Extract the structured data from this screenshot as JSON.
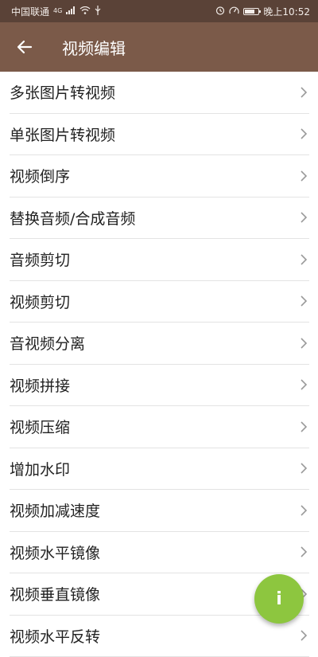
{
  "status_bar": {
    "carrier": "中国联通",
    "network_type": "4G",
    "time": "晚上10:52",
    "icons": [
      "signal-icon",
      "wifi-icon",
      "usb-icon",
      "alarm-icon",
      "speed-icon",
      "battery-icon"
    ]
  },
  "app_bar": {
    "title": "视频编辑",
    "back_icon": "arrow-left-icon"
  },
  "menu": {
    "items": [
      {
        "label": "多张图片转视频"
      },
      {
        "label": "单张图片转视频"
      },
      {
        "label": "视频倒序"
      },
      {
        "label": "替换音频/合成音频"
      },
      {
        "label": "音频剪切"
      },
      {
        "label": "视频剪切"
      },
      {
        "label": "音视频分离"
      },
      {
        "label": "视频拼接"
      },
      {
        "label": "视频压缩"
      },
      {
        "label": "增加水印"
      },
      {
        "label": "视频加减速度"
      },
      {
        "label": "视频水平镜像"
      },
      {
        "label": "视频垂直镜像"
      },
      {
        "label": "视频水平反转"
      }
    ]
  },
  "fab": {
    "label": "i"
  },
  "colors": {
    "status_bar": "#5a4237",
    "app_bar": "#7b5a49",
    "fab": "#8dc63f",
    "divider": "#e3e3e3",
    "text": "#222222"
  }
}
